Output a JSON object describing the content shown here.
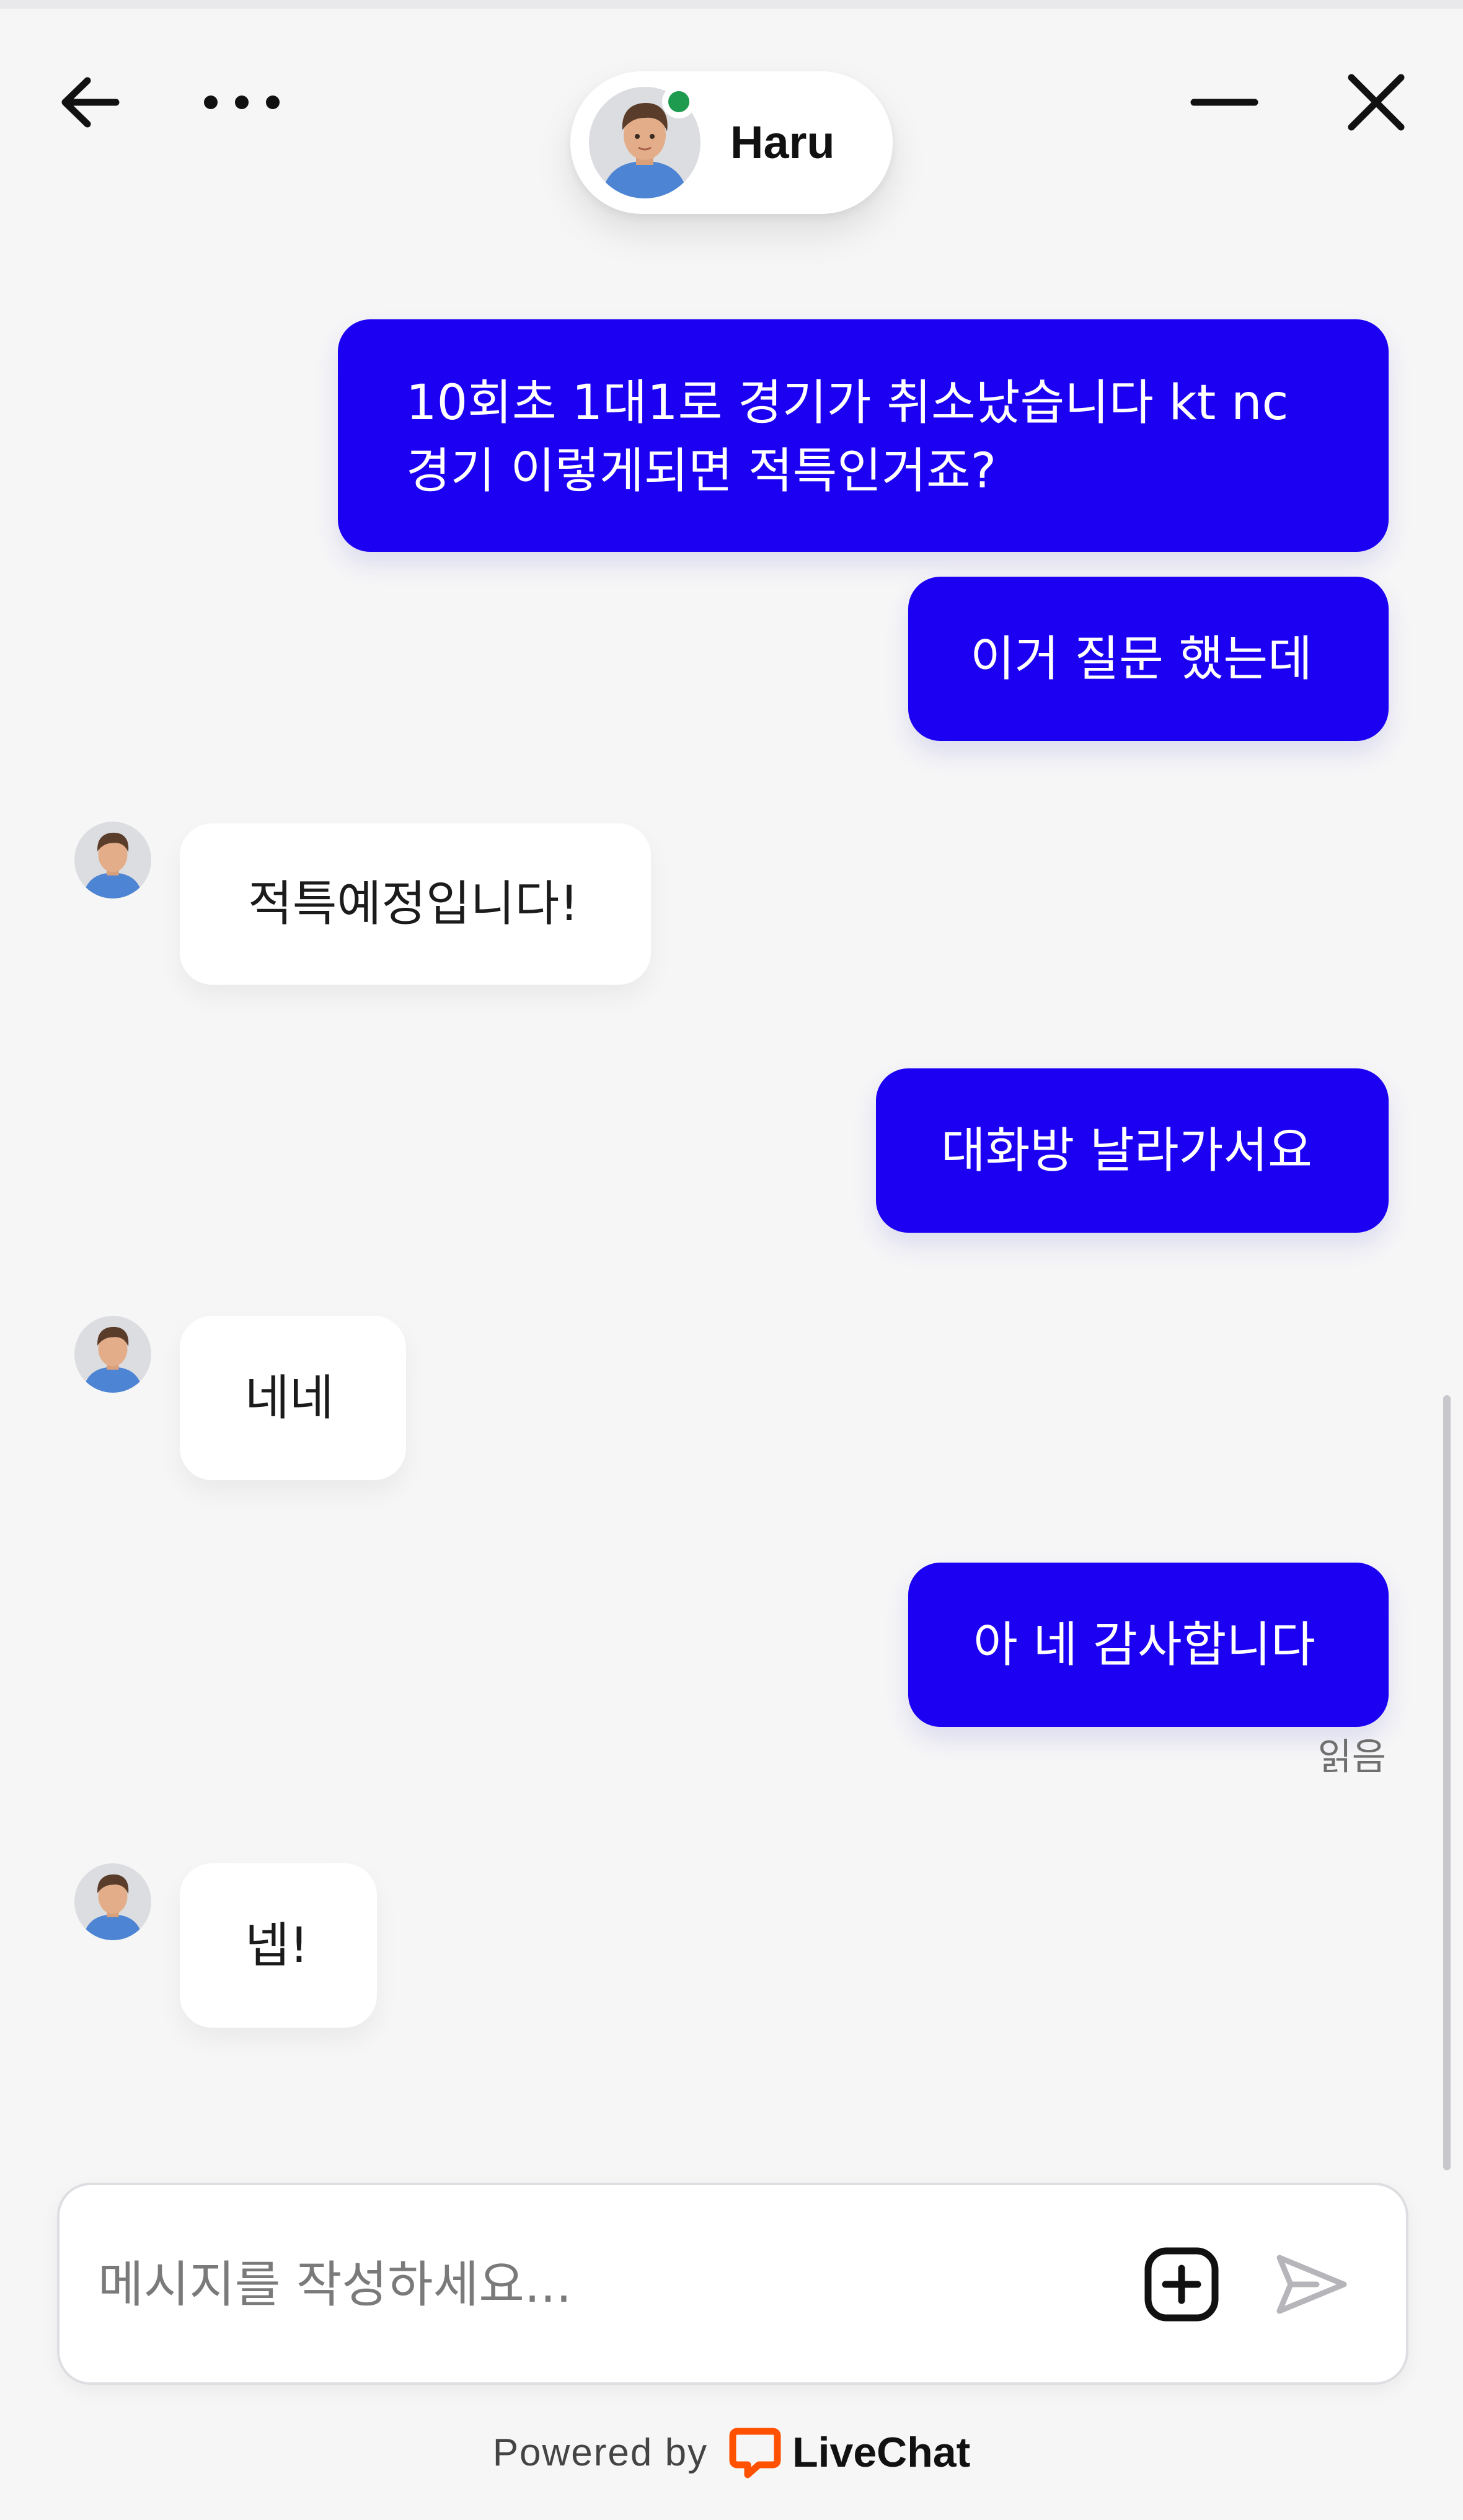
{
  "header": {
    "agent_name": "Haru",
    "online": true
  },
  "messages": [
    {
      "sender": "visitor",
      "text": "10회초 1대1로 경기가 취소났습니다 kt nc\n경기 이렇게되면 적특인거죠?"
    },
    {
      "sender": "visitor",
      "text": "이거 질문 했는데"
    },
    {
      "sender": "agent",
      "text": "적특예정입니다!"
    },
    {
      "sender": "visitor",
      "text": "대화방 날라가서요"
    },
    {
      "sender": "agent",
      "text": "네네"
    },
    {
      "sender": "visitor",
      "text": "아 네 감사합니다",
      "status": "읽음"
    },
    {
      "sender": "agent",
      "text": "넵!"
    }
  ],
  "composer": {
    "placeholder": "메시지를 작성하세요..."
  },
  "footer": {
    "powered_by": "Powered by",
    "brand": "LiveChat"
  },
  "colors": {
    "visitor_bubble": "#1c00f2",
    "agent_bubble": "#ffffff",
    "background": "#f6f6f7",
    "online_dot": "#1e9b4e",
    "brand_orange": "#ff5100"
  },
  "icons": [
    "back-arrow-icon",
    "more-dots-icon",
    "minimize-icon",
    "close-icon",
    "attach-plus-icon",
    "send-icon",
    "livechat-logo-icon"
  ]
}
